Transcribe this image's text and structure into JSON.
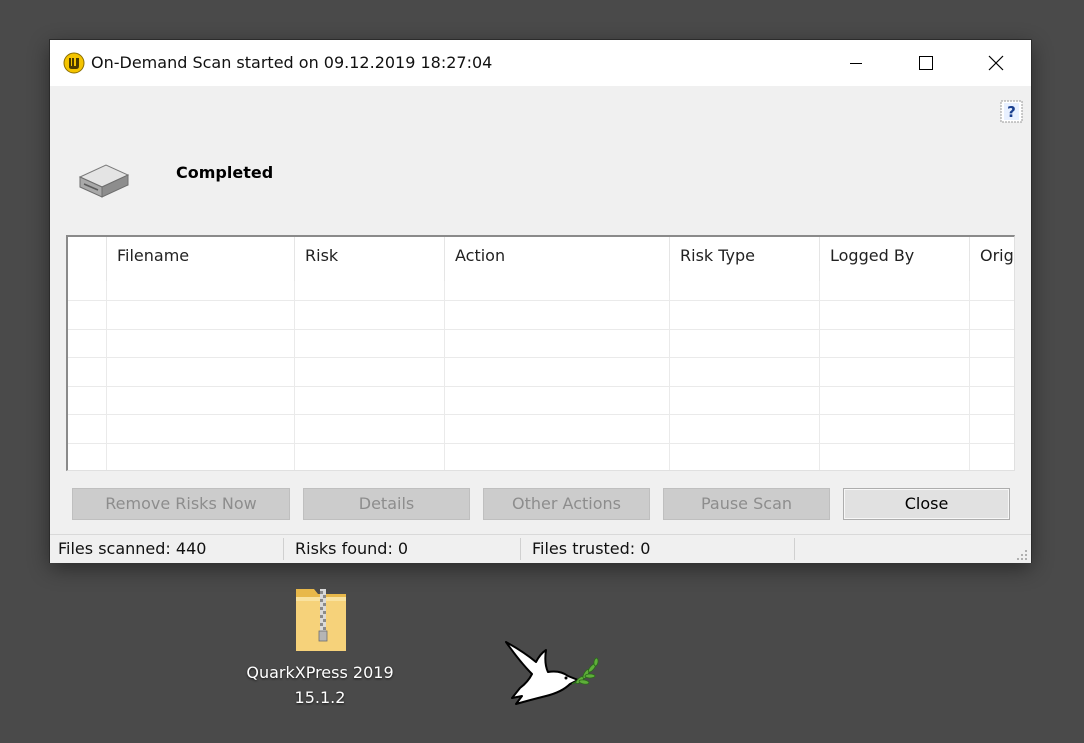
{
  "window": {
    "title": "On-Demand Scan started on 09.12.2019 18:27:04",
    "status": "Completed"
  },
  "list": {
    "columns": [
      "Filename",
      "Risk",
      "Action",
      "Risk Type",
      "Logged By",
      "Orig"
    ],
    "rows": []
  },
  "buttons": {
    "remove_risks": "Remove Risks Now",
    "details": "Details",
    "other_actions": "Other Actions",
    "pause_scan": "Pause Scan",
    "close": "Close"
  },
  "statusbar": {
    "files_scanned": "Files scanned: 440",
    "risks_found": "Risks found: 0",
    "files_trusted": "Files trusted: 0"
  },
  "desktop": {
    "zip_label_line1": "QuarkXPress 2019",
    "zip_label_line2": "15.1.2"
  },
  "icons": {
    "app": "symantec-shield-icon",
    "help": "help-icon",
    "drive": "hard-drive-icon",
    "zip": "zip-folder-icon",
    "dove": "dove-icon"
  }
}
